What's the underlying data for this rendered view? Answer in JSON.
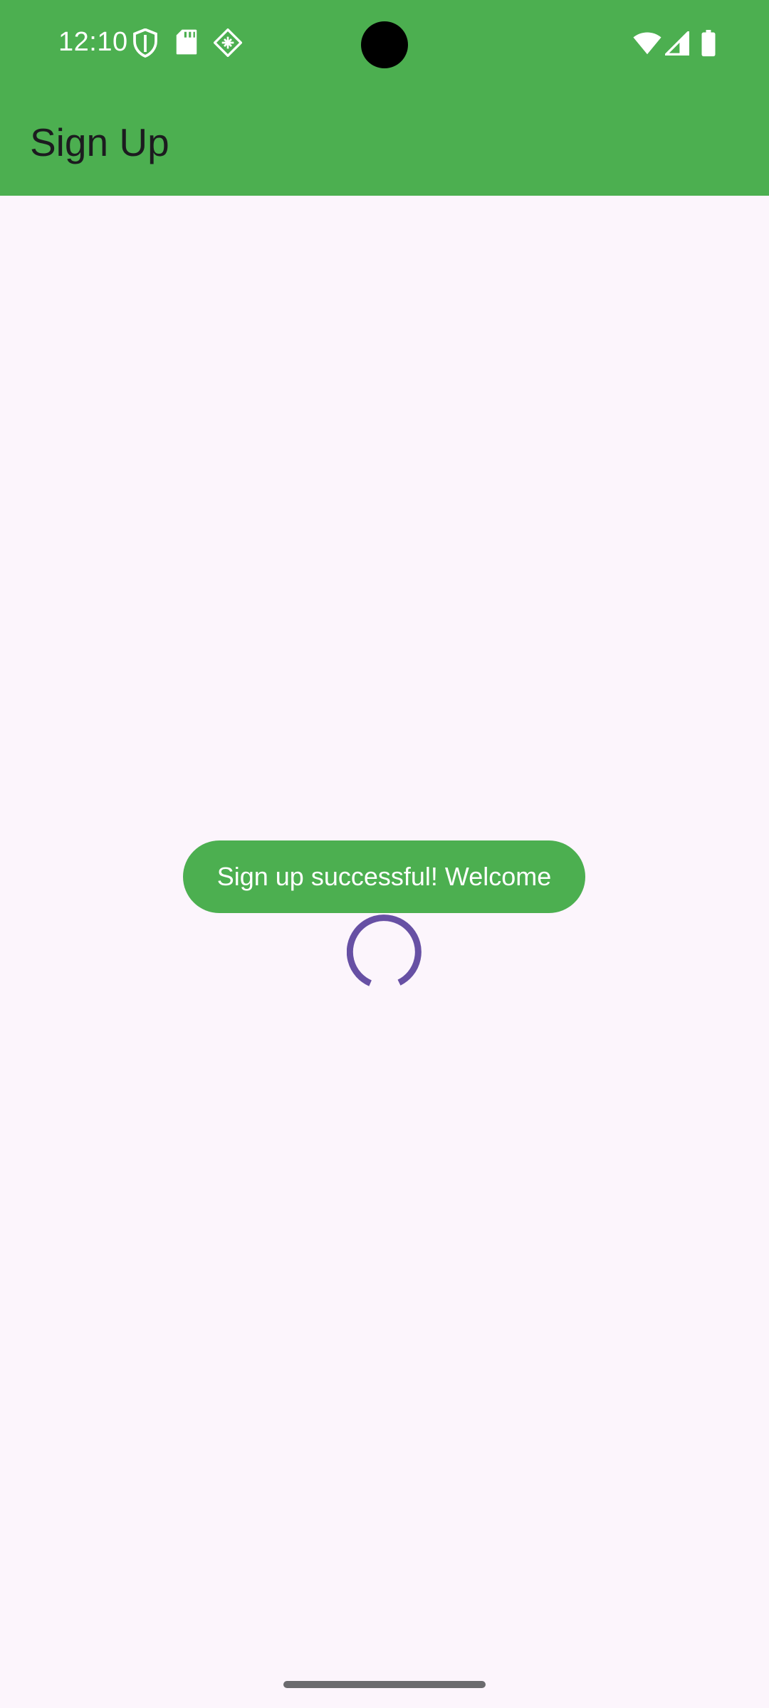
{
  "status_bar": {
    "time": "12:10",
    "left_icons": [
      "shield-icon",
      "sd-card-icon",
      "app-grid-icon"
    ],
    "right_icons": [
      "wifi-icon",
      "cell-signal-icon",
      "battery-icon"
    ]
  },
  "app_bar": {
    "title": "Sign Up"
  },
  "toast": {
    "message": "Sign up successful! Welcome"
  },
  "progress": {
    "type": "indeterminate-circular"
  },
  "colors": {
    "app_bar": "#4CAF50",
    "background": "#FCF5FC",
    "toast": "#4CAF50",
    "spinner": "#6750A4",
    "title_text": "#1C1B1F"
  }
}
